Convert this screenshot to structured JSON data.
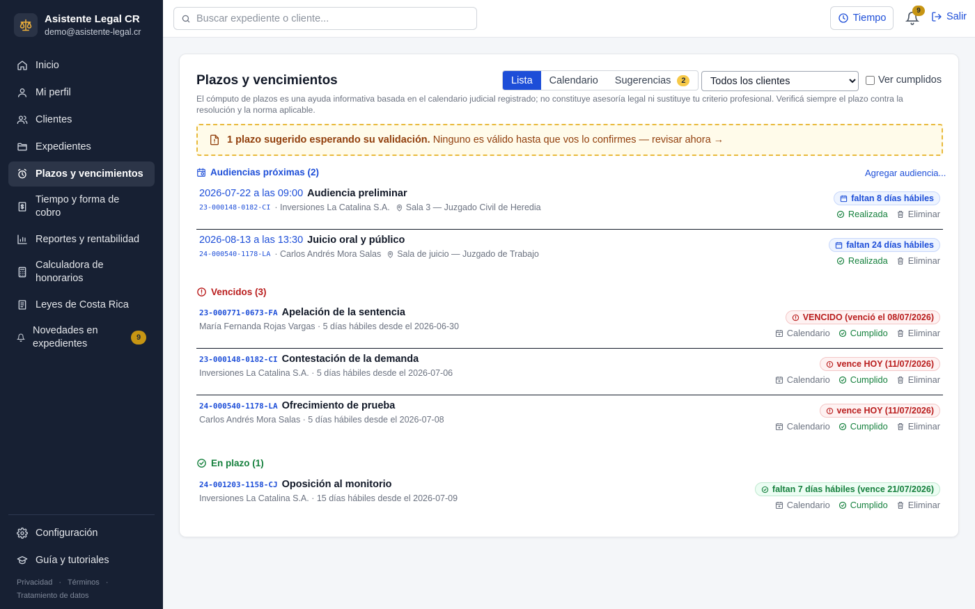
{
  "brand": {
    "title": "Asistente Legal CR",
    "email": "demo@asistente-legal.cr"
  },
  "nav": [
    {
      "label": "Inicio",
      "icon": "home-icon"
    },
    {
      "label": "Mi perfil",
      "icon": "user-icon"
    },
    {
      "label": "Clientes",
      "icon": "users-icon"
    },
    {
      "label": "Expedientes",
      "icon": "folder-icon"
    },
    {
      "label": "Plazos y vencimientos",
      "icon": "alarm-clock-icon",
      "active": true
    },
    {
      "label": "Tiempo y forma de cobro",
      "icon": "receipt-dollar-icon"
    },
    {
      "label": "Reportes y rentabilidad",
      "icon": "bar-chart-icon"
    },
    {
      "label": "Calculadora de honorarios",
      "icon": "calculator-icon"
    },
    {
      "label": "Leyes de Costa Rica",
      "icon": "book-icon"
    },
    {
      "label": "Novedades en expedientes",
      "icon": "bell-icon",
      "badge": "9"
    }
  ],
  "nav_bottom": [
    {
      "label": "Configuración",
      "icon": "gear-icon"
    },
    {
      "label": "Guía y tutoriales",
      "icon": "graduation-cap-icon"
    }
  ],
  "footer": {
    "privacy": "Privacidad",
    "terms": "Términos",
    "data": "Tratamiento de datos",
    "sep": "·"
  },
  "topbar": {
    "search_placeholder": "Buscar expediente o cliente...",
    "tiempo_label": "Tiempo",
    "notifications": "9",
    "logout_label": "Salir"
  },
  "page": {
    "title": "Plazos y vencimientos",
    "tabs": {
      "list": "Lista",
      "calendar": "Calendario",
      "suggestions": "Sugerencias",
      "suggestions_count": "2"
    },
    "client_filter": "Todos los clientes",
    "show_completed": "Ver cumplidos",
    "disclaimer": "El cómputo de plazos es una ayuda informativa basada en el calendario judicial registrado; no constituye asesoría legal ni sustituye tu criterio profesional. Verificá siempre el plazo contra la resolución y la norma aplicable.",
    "alert_bold": "1 plazo sugerido esperando su validación.",
    "alert_text": "Ninguno es válido hasta que vos lo confirmes — revisar ahora →"
  },
  "hearings": {
    "heading": "Audiencias próximas (2)",
    "add_label": "Agregar audiencia...",
    "items": [
      {
        "datetime": "2026-07-22 a las 09:00",
        "title": "Audiencia preliminar",
        "code": "23-000148-0182-CI",
        "client": "· Inversiones La Catalina S.A.",
        "location": "Sala 3 — Juzgado Civil de Heredia",
        "badge": "faltan 8 días hábiles",
        "done": "Realizada",
        "delete": "Eliminar"
      },
      {
        "datetime": "2026-08-13 a las 13:30",
        "title": "Juicio oral y público",
        "code": "24-000540-1178-LA",
        "client": "· Carlos Andrés Mora Salas",
        "location": "Sala de juicio — Juzgado de Trabajo",
        "badge": "faltan 24 días hábiles",
        "done": "Realizada",
        "delete": "Eliminar"
      }
    ]
  },
  "overdue": {
    "heading": "Vencidos (3)",
    "items": [
      {
        "code": "23-000771-0673-FA",
        "title": "Apelación de la sentencia",
        "sub": "María Fernanda Rojas Vargas · 5 días hábiles desde el 2026-06-30",
        "badge": "VENCIDO (venció el 08/07/2026)"
      },
      {
        "code": "23-000148-0182-CI",
        "title": "Contestación de la demanda",
        "sub": "Inversiones La Catalina S.A. · 5 días hábiles desde el 2026-07-06",
        "badge": "vence HOY (11/07/2026)"
      },
      {
        "code": "24-000540-1178-LA",
        "title": "Ofrecimiento de prueba",
        "sub": "Carlos Andrés Mora Salas · 5 días hábiles desde el 2026-07-08",
        "badge": "vence HOY (11/07/2026)"
      }
    ]
  },
  "ontime": {
    "heading": "En plazo (1)",
    "items": [
      {
        "code": "24-001203-1158-CJ",
        "title": "Oposición al monitorio",
        "sub": "Inversiones La Catalina S.A. · 15 días hábiles desde el 2026-07-09",
        "badge": "faltan 7 días hábiles (vence 21/07/2026)"
      }
    ]
  },
  "actions": {
    "calendar": "Calendario",
    "done": "Cumplido",
    "delete": "Eliminar"
  },
  "colors": {
    "sidebar": "#172033",
    "accent": "#1d4ed8",
    "danger": "#b91c1c",
    "success": "#15803d",
    "warning": "#c79513"
  }
}
